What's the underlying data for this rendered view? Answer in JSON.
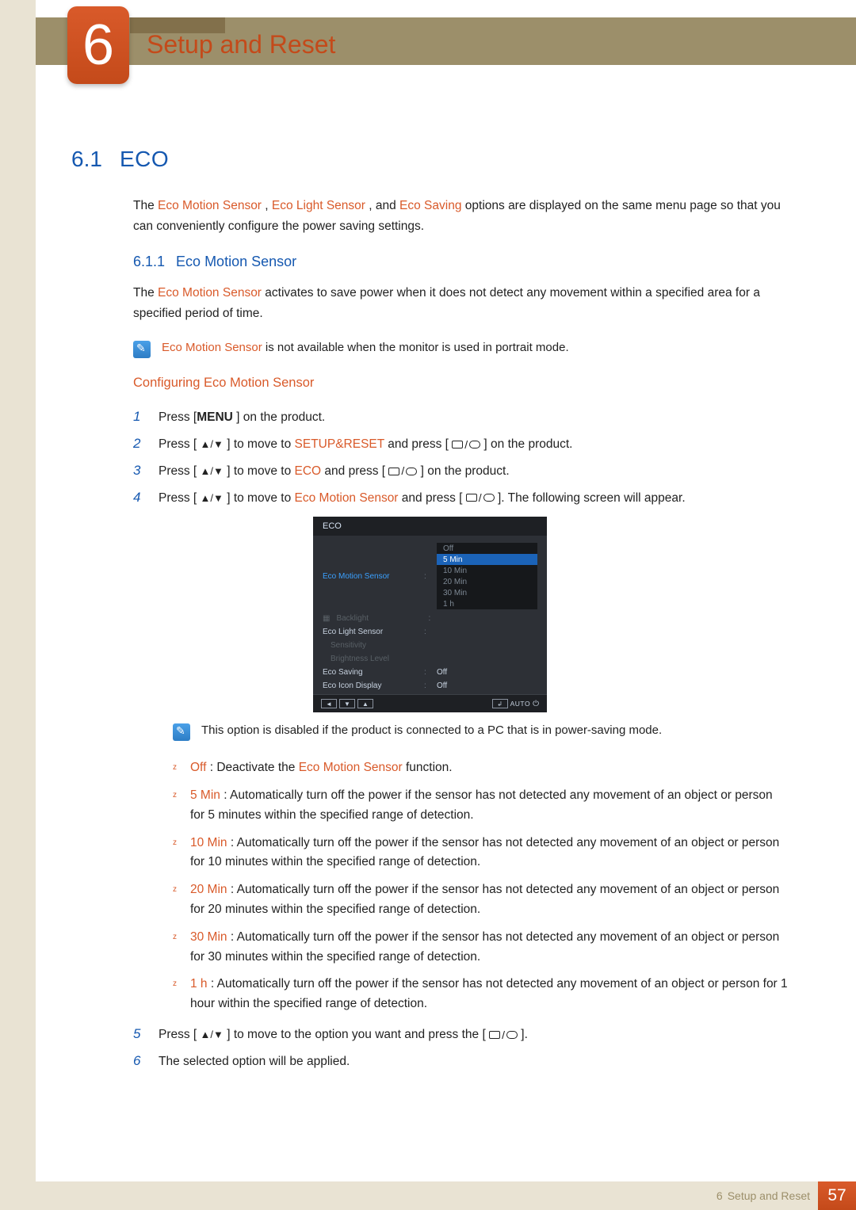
{
  "chapter": {
    "number": "6",
    "title": "Setup and Reset"
  },
  "section": {
    "number": "6.1",
    "title": "ECO"
  },
  "intro": {
    "pre": "The ",
    "t1": "Eco Motion Sensor",
    "sep1": " , ",
    "t2": "Eco Light Sensor",
    "sep2": " , and ",
    "t3": "Eco Saving",
    "post": " options are displayed on the same menu page so that you can conveniently configure the power saving settings."
  },
  "subsection": {
    "number": "6.1.1",
    "title": "Eco Motion Sensor"
  },
  "sub_intro": {
    "pre": "The ",
    "t": "Eco Motion Sensor",
    "post": "  activates to save power when it does not detect any movement within a specified area for a specified period of time."
  },
  "note1": {
    "t": "Eco Motion Sensor",
    "post": "  is not available when the monitor is used in portrait mode."
  },
  "h3": "Configuring Eco Motion Sensor",
  "steps": {
    "s1": {
      "a": "Press [",
      "b": "MENU",
      "c": " ] on the product."
    },
    "s2": {
      "a": "Press [ ",
      "arrows": "▲/▼",
      "b": " ] to move to ",
      "t": "SETUP&RESET",
      "c": " and press [ ",
      "d": " ] on the product."
    },
    "s3": {
      "a": "Press [ ",
      "arrows": "▲/▼",
      "b": " ] to move to ",
      "t": "ECO",
      "c": " and press [ ",
      "d": " ] on the product."
    },
    "s4": {
      "a": "Press [ ",
      "arrows": "▲/▼",
      "b": " ] to move to ",
      "t": "Eco Motion Sensor",
      "c": "  and press [ ",
      "d": " ]. The following screen will appear."
    },
    "s5": {
      "a": "Press [ ",
      "arrows": "▲/▼",
      "b": " ] to move to the option you want and press the [ ",
      "d": " ]."
    },
    "s6": "The selected option will be applied."
  },
  "osd": {
    "title": "ECO",
    "rows": {
      "r1": "Eco Motion Sensor",
      "r2": "Backlight",
      "r3": "Eco Light Sensor",
      "r4": "Sensitivity",
      "r5": "Brightness Level",
      "r6": "Eco Saving",
      "r7": "Eco Icon Display"
    },
    "vals": {
      "r6": "Off",
      "r7": "Off"
    },
    "options": [
      "Off",
      "5 Min",
      "10 Min",
      "20 Min",
      "30 Min",
      "1 h"
    ],
    "auto": "AUTO"
  },
  "note2": "This option is disabled if the product is connected to a PC that is in power-saving mode.",
  "opts": {
    "off": {
      "t": "Off",
      "sep": " : ",
      "a": "Deactivate the ",
      "t2": "Eco Motion Sensor",
      "b": "  function."
    },
    "m5": {
      "t": "5 Min",
      "sep": " : ",
      "body": "Automatically turn off the power if the sensor has not detected any movement of an object or person for 5 minutes within the specified range of detection."
    },
    "m10": {
      "t": "10 Min",
      "sep": " : ",
      "body": "Automatically turn off the power if the sensor has not detected any movement of an object or person for 10 minutes within the specified range of detection."
    },
    "m20": {
      "t": "20 Min",
      "sep": " : ",
      "body": "Automatically turn off the power if the sensor has not detected any movement of an object or person for 20 minutes within the specified range of detection."
    },
    "m30": {
      "t": "30 Min",
      "sep": " : ",
      "body": "Automatically turn off the power if the sensor has not detected any movement of an object or person for 30 minutes within the specified range of detection."
    },
    "h1": {
      "t": "1 h",
      "sep": " : ",
      "body": "Automatically turn off the power if the sensor has not detected any movement of an object or person for 1 hour within the specified range of detection."
    }
  },
  "footer": {
    "chapter_num": "6",
    "chapter_title": "Setup and Reset",
    "page": "57"
  }
}
